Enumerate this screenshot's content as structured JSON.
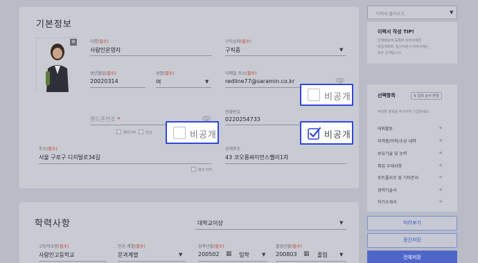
{
  "basic": {
    "title": "기본정보",
    "name": {
      "label": "이름",
      "required": "(필수)",
      "value": "사람인운영자"
    },
    "job_status": {
      "label": "구직상태",
      "required": "(필수)",
      "value": "구직중"
    },
    "birth": {
      "label": "생년월일",
      "required": "(필수)",
      "value": "20020314"
    },
    "gender": {
      "label": "성별",
      "required": "(필수)",
      "value": "여"
    },
    "email": {
      "label": "이메일 주소",
      "required": "(필수)",
      "value": "redline77@saramin.co.kr"
    },
    "mobile": {
      "label": "핸드폰번호",
      "required": "*",
      "value": ""
    },
    "phone": {
      "label": "전화번호",
      "value": "0220254733"
    },
    "overseas": "해외거주",
    "safe_number": "안심",
    "address": {
      "label": "주소",
      "required": "(필수)",
      "value": "서울 구로구 디지털로34길"
    },
    "address_detail": {
      "label": "상세주소",
      "value": "43 코오롱싸이언스밸리1차"
    },
    "overseas_region": "해외 지역",
    "toggle_text": "비공개",
    "privacy_email": {
      "label": "비공개",
      "checked": false
    },
    "privacy_mobile": {
      "label": "비공개",
      "checked": false
    },
    "privacy_phone": {
      "label": "비공개",
      "checked": true
    }
  },
  "education": {
    "title": "학력사항",
    "level": "대학교이상",
    "school_level": {
      "label": "고등학교명",
      "required": "(필수)",
      "value": "사람인고등학교"
    },
    "major": {
      "label": "전공 계열",
      "required": "(필수)",
      "value": "문과계열"
    },
    "entry": {
      "label": "입학년월",
      "required": "(필수)",
      "value": "200502",
      "status": "입학"
    },
    "graduation": {
      "label": "졸업년월",
      "required": "(필수)",
      "value": "200803",
      "status": "졸업"
    }
  },
  "sidebar": {
    "resume_dropdown": "이력서 불러오기",
    "tip_title": "이력서 작성 TIP!",
    "tip_text": [
      "인재정보에 등록된 이력서에만",
      "비공개되며, 입사지원시 이력서에는",
      "모두 공개됩니다."
    ],
    "select_title": "선택항목",
    "select_button": "입력 순서 변경",
    "select_hint": "작성할 항목을 추가하여 기입하세요.",
    "items": [
      "대외활동",
      "자격증/어학/수상 내역",
      "보유기술 및 능력",
      "취업 우대사항",
      "포트폴리오 및 기타문서",
      "경력기술서",
      "자기소개서"
    ],
    "preview_button": "미리보기",
    "save_button": "중간저장",
    "final_button": "전체저장"
  },
  "colors": {
    "accent": "#2f47d6",
    "primary_button": "#4f66c9",
    "overlay": "#b9bcc7"
  }
}
